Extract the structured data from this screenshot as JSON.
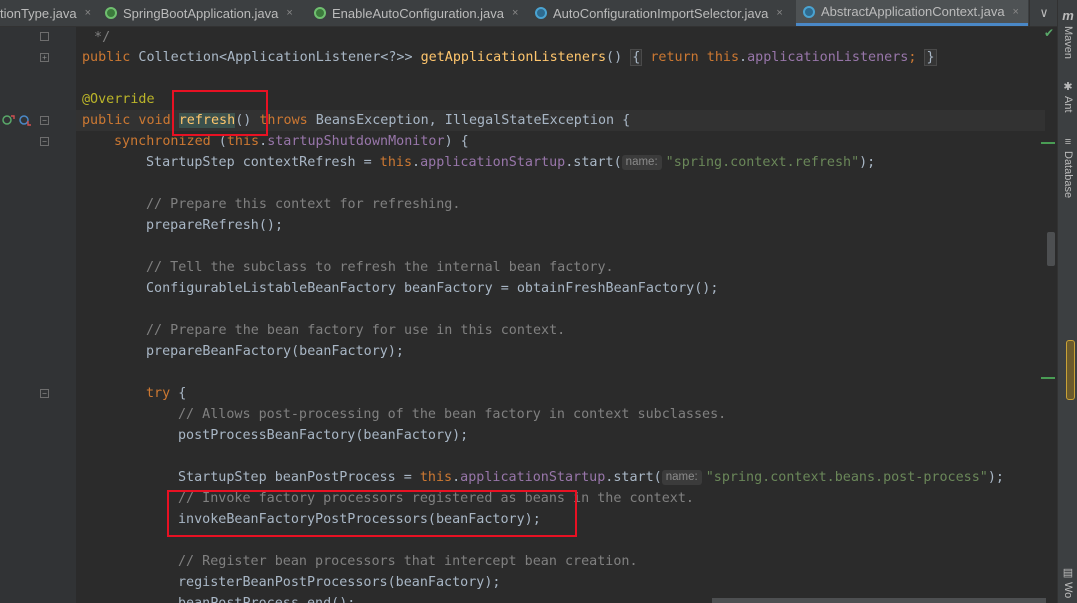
{
  "tabs": [
    {
      "label": "tionType.java",
      "icon": "class-icon",
      "active": false
    },
    {
      "label": "SpringBootApplication.java",
      "icon": "spring-annotation-icon",
      "active": false
    },
    {
      "label": "EnableAutoConfiguration.java",
      "icon": "spring-annotation-icon",
      "active": false
    },
    {
      "label": "AutoConfigurationImportSelector.java",
      "icon": "class-icon",
      "active": false
    },
    {
      "label": "AbstractApplicationContext.java",
      "icon": "class-icon",
      "active": true
    }
  ],
  "tab_close": "×",
  "tab_overflow": "∨",
  "right_tools": [
    {
      "label": "Maven",
      "icon": "m"
    },
    {
      "label": "Ant",
      "icon": "✱"
    },
    {
      "label": "Database",
      "icon": "≡"
    },
    {
      "label": "Wo",
      "icon": "▤"
    }
  ],
  "code": {
    "l0": " */",
    "l1_kw": "public",
    "l1_type": " Collection<ApplicationListener<?>> ",
    "l1_fn": "getApplicationListeners",
    "l1_paren": "()",
    "l1_open": "{",
    "l1_ret": "return",
    "l1_this": "this",
    "l1_dot": ".",
    "l1_fld": "applicationListeners",
    "l1_semi": ";",
    "l1_close": "}",
    "l3": "@Override",
    "l4_kw": "public void ",
    "l4_fn": "refresh",
    "l4_paren": "() ",
    "l4_throws": "throws",
    "l4_rest": " BeansException, IllegalStateException {",
    "l5_kw": "synchronized",
    "l5_a": " (",
    "l5_this": "this",
    "l5_dot": ".",
    "l5_fld": "startupShutdownMonitor",
    "l5_b": ") {",
    "l6_a": "StartupStep contextRefresh = ",
    "l6_this": "this",
    "l6_dot": ".",
    "l6_fld": "applicationStartup",
    "l6_b": ".start(",
    "l6_hint": "name:",
    "l6_str": "\"spring.context.refresh\"",
    "l6_c": ");",
    "l8": "// Prepare this context for refreshing.",
    "l9": "prepareRefresh();",
    "l11": "// Tell the subclass to refresh the internal bean factory.",
    "l12": "ConfigurableListableBeanFactory beanFactory = obtainFreshBeanFactory();",
    "l14": "// Prepare the bean factory for use in this context.",
    "l15": "prepareBeanFactory(beanFactory);",
    "l17_kw": "try",
    "l17_b": " {",
    "l18": "// Allows post-processing of the bean factory in context subclasses.",
    "l19": "postProcessBeanFactory(beanFactory);",
    "l21_a": "StartupStep beanPostProcess = ",
    "l21_this": "this",
    "l21_dot": ".",
    "l21_fld": "applicationStartup",
    "l21_b": ".start(",
    "l21_hint": "name:",
    "l21_str": "\"spring.context.beans.post-process\"",
    "l21_c": ");",
    "l22": "// Invoke factory processors registered as beans in the context.",
    "l23": "invokeBeanFactoryPostProcessors(beanFactory);",
    "l25": "// Register bean processors that intercept bean creation.",
    "l26": "registerBeanPostProcessors(beanFactory);",
    "l27": "beanPostProcess.end();"
  },
  "colors": {
    "keyword": "#cc7832",
    "method": "#ffc66d",
    "field": "#9876aa",
    "string": "#6a8759",
    "comment": "#808080",
    "annotation": "#bbb529",
    "annotation_box": "#e81123"
  }
}
